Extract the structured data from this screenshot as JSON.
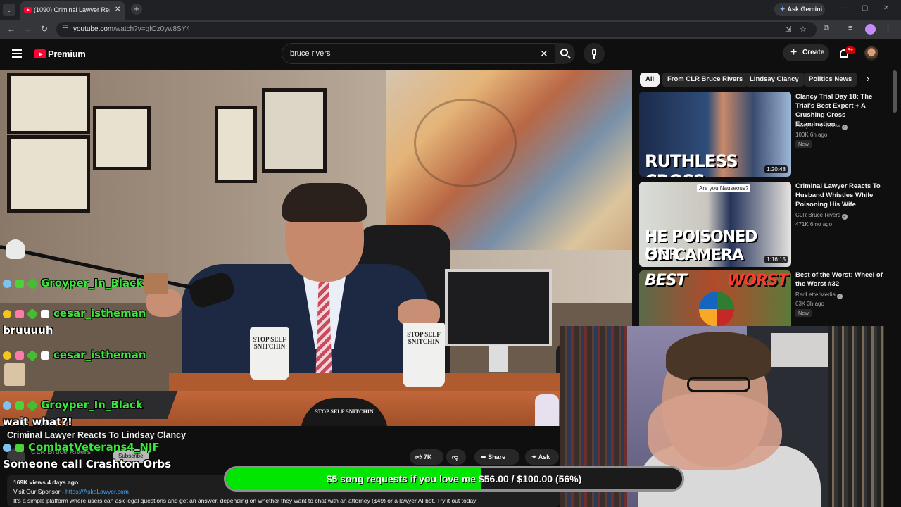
{
  "browser": {
    "tab_title": "(1090) Criminal Lawyer Reacts T",
    "tab_close": "✕",
    "new_tab": "+",
    "gemini_label": "Ask Gemini",
    "url_host": "youtube.com",
    "url_path": "/watch?v=gfOz0yw8SY4"
  },
  "masthead": {
    "brand": "Premium",
    "search_value": "bruce rivers",
    "create_label": "Create",
    "notif_count": "9+"
  },
  "chips": [
    "All",
    "From CLR Bruce Rivers",
    "Lindsay Clancy",
    "Politics News"
  ],
  "recommendations": [
    {
      "title": "Clancy Trial Day 18: The Trial's Best Expert + A Crushing Cross Examination",
      "channel": "Lawyer You Know",
      "stats": "100K  6h ago",
      "badge": "New",
      "duration": "1:20:48",
      "thumb_text": "RUTHLESS CROSS"
    },
    {
      "title": "Criminal Lawyer Reacts To Husband Whistles While Poisoning His Wife",
      "channel": "CLR Bruce Rivers",
      "stats": "471K  6mo ago",
      "badge": "",
      "duration": "1:16:15",
      "thumb_text_1": "HE POISONED HER",
      "thumb_text_2": "ON CAMERA",
      "thumb_note": "Are you Nauseous?"
    },
    {
      "title": "Best of the Worst: Wheel of the Worst #32",
      "channel": "RedLetterMedia",
      "stats": "63K  3h ago",
      "badge": "New",
      "duration": "",
      "thumb_text_1": "BEST",
      "thumb_text_2": "WORST"
    }
  ],
  "player": {
    "mug_text": "STOP SELF SNITCHIN",
    "cap_text": "STOP SELF SNITCHIN"
  },
  "chat": [
    {
      "user": "Groyper_In_Black",
      "color": "#39e639",
      "message": ""
    },
    {
      "user": "cesar_istheman",
      "color": "#39e639",
      "message": "bruuuuh"
    },
    {
      "user": "cesar_istheman",
      "color": "#39e639",
      "message": ""
    },
    {
      "user": "Groyper_In_Black",
      "color": "#39e639",
      "message": "wait what?!"
    },
    {
      "user": "CombatVeterans4_NJF",
      "color": "#39e639",
      "message": "Someone call Crashton Orbs"
    }
  ],
  "video": {
    "title": "Criminal Lawyer Reacts To Lindsay Clancy",
    "channel": "CLR Bruce Rivers",
    "subscribe": "Subscribe",
    "likes": "7K",
    "share": "Share",
    "ask": "Ask",
    "views": "169K views  4 days ago",
    "sponsor_prefix": "Visit Our Sponsor - ",
    "sponsor_link": "https://AskaLawyer.com",
    "desc_line": "It's a simple platform where users can ask legal questions and get an answer, depending on whether they want to chat with an attorney ($49) or a lawyer AI bot. Try it out today!"
  },
  "goal": {
    "text": "$5 song requests if you love me $56.00 / $100.00 (56%)",
    "progress": 0.56,
    "fill_color": "#00e600"
  }
}
